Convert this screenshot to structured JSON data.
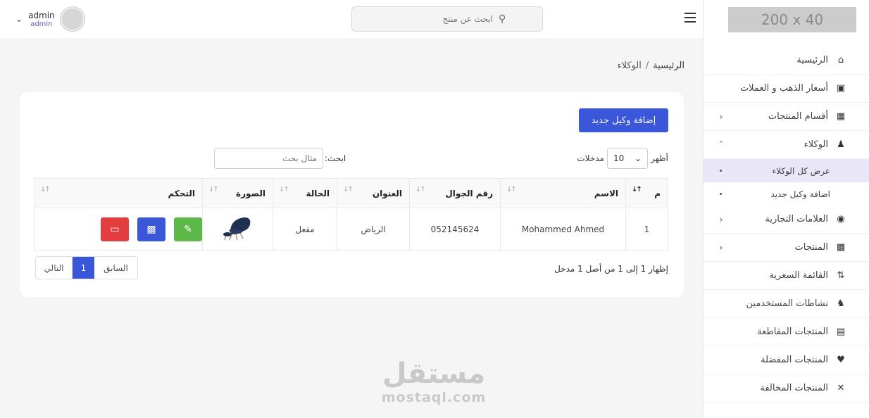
{
  "header": {
    "user_name": "admin",
    "user_role": "admin",
    "search_placeholder": "ابحث عن منتج"
  },
  "sidebar": {
    "logo_text": "200 x 40",
    "items": [
      {
        "label": "الرئيسية",
        "icon": "home-icon"
      },
      {
        "label": "أسعار الذهب و العملات",
        "icon": "money-icon"
      },
      {
        "label": "أقسام المنتجات",
        "icon": "box-icon"
      },
      {
        "label": "الوكلاء",
        "icon": "agent-icon"
      },
      {
        "label": "العلامات التجارية",
        "icon": "brand-icon"
      },
      {
        "label": "المنتجات",
        "icon": "boxes-icon"
      },
      {
        "label": "القائمة السعرية",
        "icon": "sort-icon"
      },
      {
        "label": "نشاطات المستخدمين",
        "icon": "user-secret-icon"
      },
      {
        "label": "المنتجات المقاطعة",
        "icon": "boycott-icon"
      },
      {
        "label": "المنتجات المفضلة",
        "icon": "heart-icon"
      },
      {
        "label": "المنتجات المخالفة",
        "icon": "close-icon"
      }
    ],
    "agents_submenu": [
      {
        "label": "عرض كل الوكلاء"
      },
      {
        "label": "اضافة وكيل جديد"
      }
    ]
  },
  "breadcrumb": {
    "home": "الرئيسية",
    "separator": "/",
    "current": "الوكلاء"
  },
  "page": {
    "add_button": "إضافة وكيل جديد",
    "show_label": "أظهر",
    "entries_label": "مدخلات",
    "page_size": "10",
    "search_label": "ابحث:",
    "search_placeholder": "مثال بحث",
    "info": "إظهار 1 إلى 1 من أصل 1 مدخل",
    "pager": {
      "prev": "السابق",
      "current": "1",
      "next": "التالي"
    }
  },
  "table": {
    "columns": [
      "م",
      "الاسم",
      "رقم الجوال",
      "العنوان",
      "الحالة",
      "الصورة",
      "التحكم"
    ],
    "rows": [
      {
        "index": "1",
        "name": "Mohammed Ahmed",
        "phone": "052145624",
        "address": "الرياض",
        "status": "مفعل"
      }
    ]
  },
  "watermark": {
    "arabic": "مستقل",
    "english": "mostaql.com"
  },
  "colors": {
    "primary": "#3b57d9",
    "success": "#5cb848",
    "danger": "#e23e40",
    "active_submenu_bg": "#e8e6f7"
  }
}
